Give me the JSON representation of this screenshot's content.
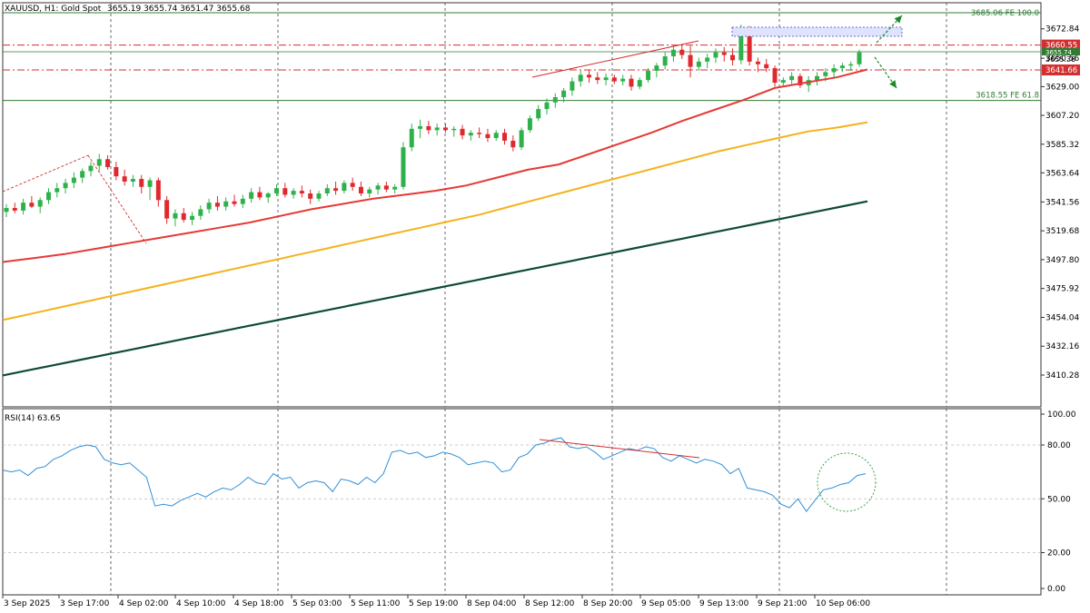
{
  "header": {
    "symbol": "XAUUSD, H1:  Gold Spot",
    "ohlc": "3655.19 3655.74 3651.47 3655.68"
  },
  "colors": {
    "bull": "#2eb14a",
    "bear": "#e0292e",
    "ma_fast": "#e53935",
    "ma_mid": "#f5b21b",
    "ma_slow": "#0e4a36",
    "rsi": "#2f8fd8",
    "fib": "#2e7d32",
    "level_red": "#d32f2f",
    "grid": "#444444"
  },
  "levels": {
    "fe100_label": "3685.06 FE 100.0",
    "fe618_label": "3618.55 FE 61.8",
    "res_label": "3660.55",
    "sup_label": "3641.66",
    "price_label_top": "3655.74",
    "price_label_bot": "3655.36"
  },
  "rsi": {
    "label": "RSI(14) 63.65",
    "ticks": [
      "100.00",
      "80.00",
      "50.00",
      "20.00",
      "0.00"
    ]
  },
  "chart_data": {
    "type": "line",
    "title": "XAUUSD, H1: Gold Spot",
    "ylim": [
      3395,
      3690
    ],
    "y_ticks": [
      "3672.84",
      "3650.56",
      "3629.00",
      "3607.20",
      "3585.32",
      "3563.64",
      "3541.56",
      "3519.68",
      "3497.80",
      "3475.92",
      "3454.04",
      "3432.16",
      "3410.28"
    ],
    "x_ticks": [
      "3 Sep 2025",
      "3 Sep 17:00",
      "4 Sep 02:00",
      "4 Sep 10:00",
      "4 Sep 18:00",
      "5 Sep 03:00",
      "5 Sep 11:00",
      "5 Sep 19:00",
      "8 Sep 04:00",
      "8 Sep 12:00",
      "8 Sep 20:00",
      "9 Sep 05:00",
      "9 Sep 13:00",
      "9 Sep 21:00",
      "10 Sep 06:00"
    ],
    "ohlc": [
      [
        3534,
        3540,
        3530,
        3537
      ],
      [
        3537,
        3541,
        3533,
        3535
      ],
      [
        3535,
        3544,
        3532,
        3541
      ],
      [
        3541,
        3546,
        3537,
        3538
      ],
      [
        3538,
        3545,
        3533,
        3543
      ],
      [
        3543,
        3552,
        3540,
        3549
      ],
      [
        3549,
        3556,
        3545,
        3552
      ],
      [
        3552,
        3559,
        3548,
        3556
      ],
      [
        3556,
        3564,
        3552,
        3560
      ],
      [
        3560,
        3567,
        3556,
        3565
      ],
      [
        3565,
        3572,
        3561,
        3569
      ],
      [
        3569,
        3578,
        3565,
        3574
      ],
      [
        3574,
        3577,
        3566,
        3568
      ],
      [
        3568,
        3572,
        3558,
        3561
      ],
      [
        3561,
        3566,
        3554,
        3557
      ],
      [
        3557,
        3562,
        3553,
        3559
      ],
      [
        3559,
        3562,
        3548,
        3553
      ],
      [
        3553,
        3560,
        3543,
        3558
      ],
      [
        3558,
        3560,
        3538,
        3543
      ],
      [
        3543,
        3546,
        3525,
        3529
      ],
      [
        3529,
        3536,
        3523,
        3533
      ],
      [
        3533,
        3537,
        3526,
        3528
      ],
      [
        3528,
        3534,
        3524,
        3531
      ],
      [
        3531,
        3539,
        3528,
        3536
      ],
      [
        3536,
        3544,
        3533,
        3541
      ],
      [
        3541,
        3546,
        3535,
        3538
      ],
      [
        3538,
        3545,
        3535,
        3542
      ],
      [
        3542,
        3547,
        3538,
        3540
      ],
      [
        3540,
        3547,
        3537,
        3544
      ],
      [
        3544,
        3552,
        3541,
        3549
      ],
      [
        3549,
        3553,
        3543,
        3545
      ],
      [
        3545,
        3549,
        3541,
        3548
      ],
      [
        3548,
        3555,
        3546,
        3552
      ],
      [
        3552,
        3556,
        3545,
        3547
      ],
      [
        3547,
        3552,
        3544,
        3550
      ],
      [
        3550,
        3554,
        3545,
        3548
      ],
      [
        3548,
        3551,
        3540,
        3544
      ],
      [
        3544,
        3550,
        3542,
        3548
      ],
      [
        3548,
        3555,
        3546,
        3552
      ],
      [
        3552,
        3557,
        3547,
        3550
      ],
      [
        3550,
        3558,
        3548,
        3556
      ],
      [
        3556,
        3560,
        3550,
        3553
      ],
      [
        3553,
        3557,
        3546,
        3548
      ],
      [
        3548,
        3553,
        3545,
        3551
      ],
      [
        3551,
        3556,
        3547,
        3554
      ],
      [
        3554,
        3557,
        3549,
        3551
      ],
      [
        3551,
        3555,
        3548,
        3553
      ],
      [
        3553,
        3587,
        3551,
        3583
      ],
      [
        3583,
        3601,
        3580,
        3597
      ],
      [
        3597,
        3604,
        3590,
        3599
      ],
      [
        3599,
        3603,
        3593,
        3596
      ],
      [
        3596,
        3601,
        3592,
        3598
      ],
      [
        3598,
        3601,
        3594,
        3596
      ],
      [
        3596,
        3599,
        3591,
        3597
      ],
      [
        3597,
        3600,
        3589,
        3592
      ],
      [
        3592,
        3596,
        3588,
        3594
      ],
      [
        3594,
        3598,
        3590,
        3593
      ],
      [
        3593,
        3597,
        3587,
        3590
      ],
      [
        3590,
        3596,
        3588,
        3594
      ],
      [
        3594,
        3597,
        3585,
        3588
      ],
      [
        3588,
        3592,
        3580,
        3583
      ],
      [
        3583,
        3598,
        3581,
        3596
      ],
      [
        3596,
        3607,
        3594,
        3605
      ],
      [
        3605,
        3615,
        3603,
        3612
      ],
      [
        3612,
        3620,
        3608,
        3617
      ],
      [
        3617,
        3624,
        3613,
        3621
      ],
      [
        3621,
        3628,
        3617,
        3626
      ],
      [
        3626,
        3636,
        3622,
        3633
      ],
      [
        3633,
        3641,
        3629,
        3638
      ],
      [
        3638,
        3642,
        3632,
        3636
      ],
      [
        3636,
        3640,
        3631,
        3634
      ],
      [
        3634,
        3639,
        3630,
        3636
      ],
      [
        3636,
        3638,
        3631,
        3633
      ],
      [
        3633,
        3638,
        3630,
        3635
      ],
      [
        3635,
        3638,
        3626,
        3629
      ],
      [
        3629,
        3636,
        3627,
        3634
      ],
      [
        3634,
        3643,
        3632,
        3641
      ],
      [
        3641,
        3647,
        3636,
        3645
      ],
      [
        3645,
        3655,
        3642,
        3652
      ],
      [
        3652,
        3660,
        3648,
        3657
      ],
      [
        3657,
        3661,
        3650,
        3653
      ],
      [
        3653,
        3660,
        3636,
        3644
      ],
      [
        3644,
        3651,
        3641,
        3648
      ],
      [
        3648,
        3654,
        3643,
        3651
      ],
      [
        3651,
        3658,
        3647,
        3655
      ],
      [
        3655,
        3659,
        3648,
        3653
      ],
      [
        3653,
        3658,
        3645,
        3649
      ],
      [
        3649,
        3676,
        3646,
        3673
      ],
      [
        3673,
        3675,
        3645,
        3648
      ],
      [
        3648,
        3651,
        3640,
        3646
      ],
      [
        3646,
        3650,
        3640,
        3643
      ],
      [
        3643,
        3645,
        3629,
        3632
      ],
      [
        3632,
        3636,
        3629,
        3634
      ],
      [
        3634,
        3640,
        3631,
        3637
      ],
      [
        3637,
        3639,
        3628,
        3630
      ],
      [
        3630,
        3637,
        3625,
        3634
      ],
      [
        3634,
        3640,
        3630,
        3637
      ],
      [
        3637,
        3643,
        3633,
        3640
      ],
      [
        3640,
        3646,
        3636,
        3643
      ],
      [
        3643,
        3647,
        3640,
        3645
      ],
      [
        3645,
        3648,
        3641,
        3646
      ],
      [
        3646,
        3657,
        3644,
        3655
      ]
    ],
    "series": [
      {
        "name": "MA fast",
        "values": [
          3496,
          3499,
          3502,
          3506,
          3510,
          3514,
          3518,
          3522,
          3526,
          3531,
          3536,
          3540,
          3544,
          3547,
          3550,
          3554,
          3560,
          3566,
          3570,
          3578,
          3586,
          3594,
          3603,
          3611,
          3619,
          3628,
          3632,
          3636,
          3642
        ]
      },
      {
        "name": "MA mid",
        "values": [
          3452,
          3457,
          3462,
          3467,
          3472,
          3477,
          3482,
          3487,
          3492,
          3497,
          3502,
          3507,
          3512,
          3517,
          3522,
          3527,
          3532,
          3538,
          3544,
          3550,
          3556,
          3562,
          3568,
          3574,
          3580,
          3585,
          3590,
          3595,
          3598,
          3602
        ]
      },
      {
        "name": "MA slow",
        "values": [
          3410,
          3414,
          3418,
          3422,
          3426,
          3430,
          3434,
          3438,
          3442,
          3446,
          3450,
          3454,
          3458,
          3462,
          3466,
          3470,
          3474,
          3478,
          3482,
          3486,
          3490,
          3494,
          3498,
          3502,
          3506,
          3510,
          3514,
          3518,
          3522,
          3526,
          3530,
          3534,
          3538,
          3542
        ]
      },
      {
        "name": "RSI(14)",
        "values": [
          66,
          65,
          66,
          63,
          67,
          68,
          72,
          74,
          77,
          79,
          80,
          79,
          72,
          70,
          69,
          70,
          66,
          62,
          46,
          47,
          46,
          49,
          51,
          53,
          51,
          54,
          56,
          55,
          58,
          62,
          59,
          58,
          64,
          61,
          62,
          56,
          59,
          60,
          59,
          54,
          61,
          60,
          58,
          62,
          59,
          64,
          76,
          77,
          75,
          76,
          73,
          74,
          76,
          75,
          73,
          69,
          70,
          71,
          70,
          65,
          66,
          73,
          75,
          80,
          81,
          83,
          84,
          79,
          78,
          79,
          76,
          72,
          74,
          76,
          78,
          77,
          79,
          78,
          73,
          71,
          74,
          72,
          70,
          72,
          71,
          69,
          64,
          67,
          56,
          55,
          54,
          52,
          47,
          45,
          50,
          43,
          49,
          55,
          56,
          58,
          59,
          63,
          64
        ]
      }
    ],
    "hlines": [
      3685.06,
      3660.55,
      3641.66,
      3618.55
    ],
    "rsi_ylim": [
      0,
      100
    ]
  }
}
